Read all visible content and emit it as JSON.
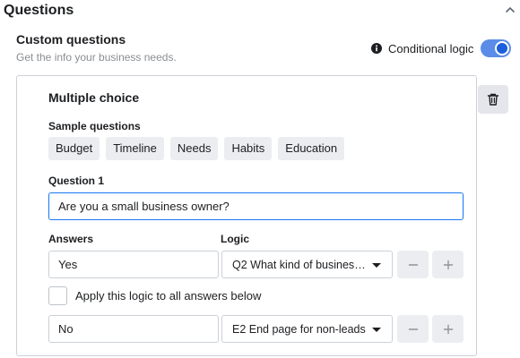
{
  "section": {
    "title": "Questions"
  },
  "custom_questions": {
    "title": "Custom questions",
    "subtitle": "Get the info your business needs.",
    "conditional_logic_label": "Conditional logic",
    "conditional_logic_enabled": true
  },
  "question_card": {
    "type_title": "Multiple choice",
    "sample_label": "Sample questions",
    "samples": [
      "Budget",
      "Timeline",
      "Needs",
      "Habits",
      "Education"
    ],
    "question_label": "Question 1",
    "question_value": "Are you a small business owner?",
    "answers_label": "Answers",
    "logic_label": "Logic",
    "answers": [
      {
        "value": "Yes",
        "logic": "Q2 What kind of business do you own?"
      },
      {
        "value": "No",
        "logic": "E2 End page for non-leads"
      }
    ],
    "apply_logic_label": "Apply this logic to all answers below",
    "apply_logic_checked": false
  },
  "icons": {
    "collapse": "chevron-up-icon",
    "info": "info-icon",
    "delete": "trash-icon",
    "dropdown": "caret-down-icon",
    "minus": "minus-icon",
    "plus": "plus-icon"
  },
  "colors": {
    "accent": "#1877f2",
    "toggle_track": "#5b8de8",
    "toggle_knob": "#1b5fdc",
    "chip_bg": "#ebedf0",
    "muted_text": "#8a8d91"
  }
}
